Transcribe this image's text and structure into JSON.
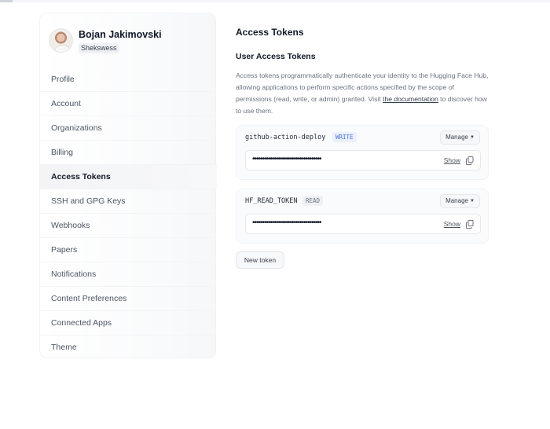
{
  "user": {
    "name": "Bojan Jakimovski",
    "handle": "Shekswess"
  },
  "sidebar": {
    "items": [
      {
        "label": "Profile"
      },
      {
        "label": "Account"
      },
      {
        "label": "Organizations"
      },
      {
        "label": "Billing"
      },
      {
        "label": "Access Tokens",
        "active": true
      },
      {
        "label": "SSH and GPG Keys"
      },
      {
        "label": "Webhooks"
      },
      {
        "label": "Papers"
      },
      {
        "label": "Notifications"
      },
      {
        "label": "Content Preferences"
      },
      {
        "label": "Connected Apps"
      },
      {
        "label": "Theme"
      }
    ]
  },
  "main": {
    "title": "Access Tokens",
    "section_title": "User Access Tokens",
    "description": {
      "text_before": "Access tokens programmatically authenticate your identity to the Hugging Face Hub, allowing applications to perform specific actions specified by the scope of permissions (read, write, or admin) granted. Visit ",
      "link_text": "the documentation",
      "text_after": " to discover how to use them."
    },
    "tokens": [
      {
        "name": "github-action-deploy",
        "permission": "WRITE",
        "masked_value": "•••••••••••••••••••••••••••••••••••",
        "manage_label": "Manage",
        "show_label": "Show"
      },
      {
        "name": "HF_READ_TOKEN",
        "permission": "READ",
        "masked_value": "•••••••••••••••••••••••••••••••••••",
        "manage_label": "Manage",
        "show_label": "Show"
      }
    ],
    "new_token_label": "New token"
  },
  "icons": {
    "manage_chevron": "chevron-down-icon",
    "copy": "copy-icon"
  },
  "colors": {
    "write_badge_bg": "#eaf0fd",
    "write_badge_text": "#4f73d8",
    "read_badge_bg": "#eef0f3"
  }
}
